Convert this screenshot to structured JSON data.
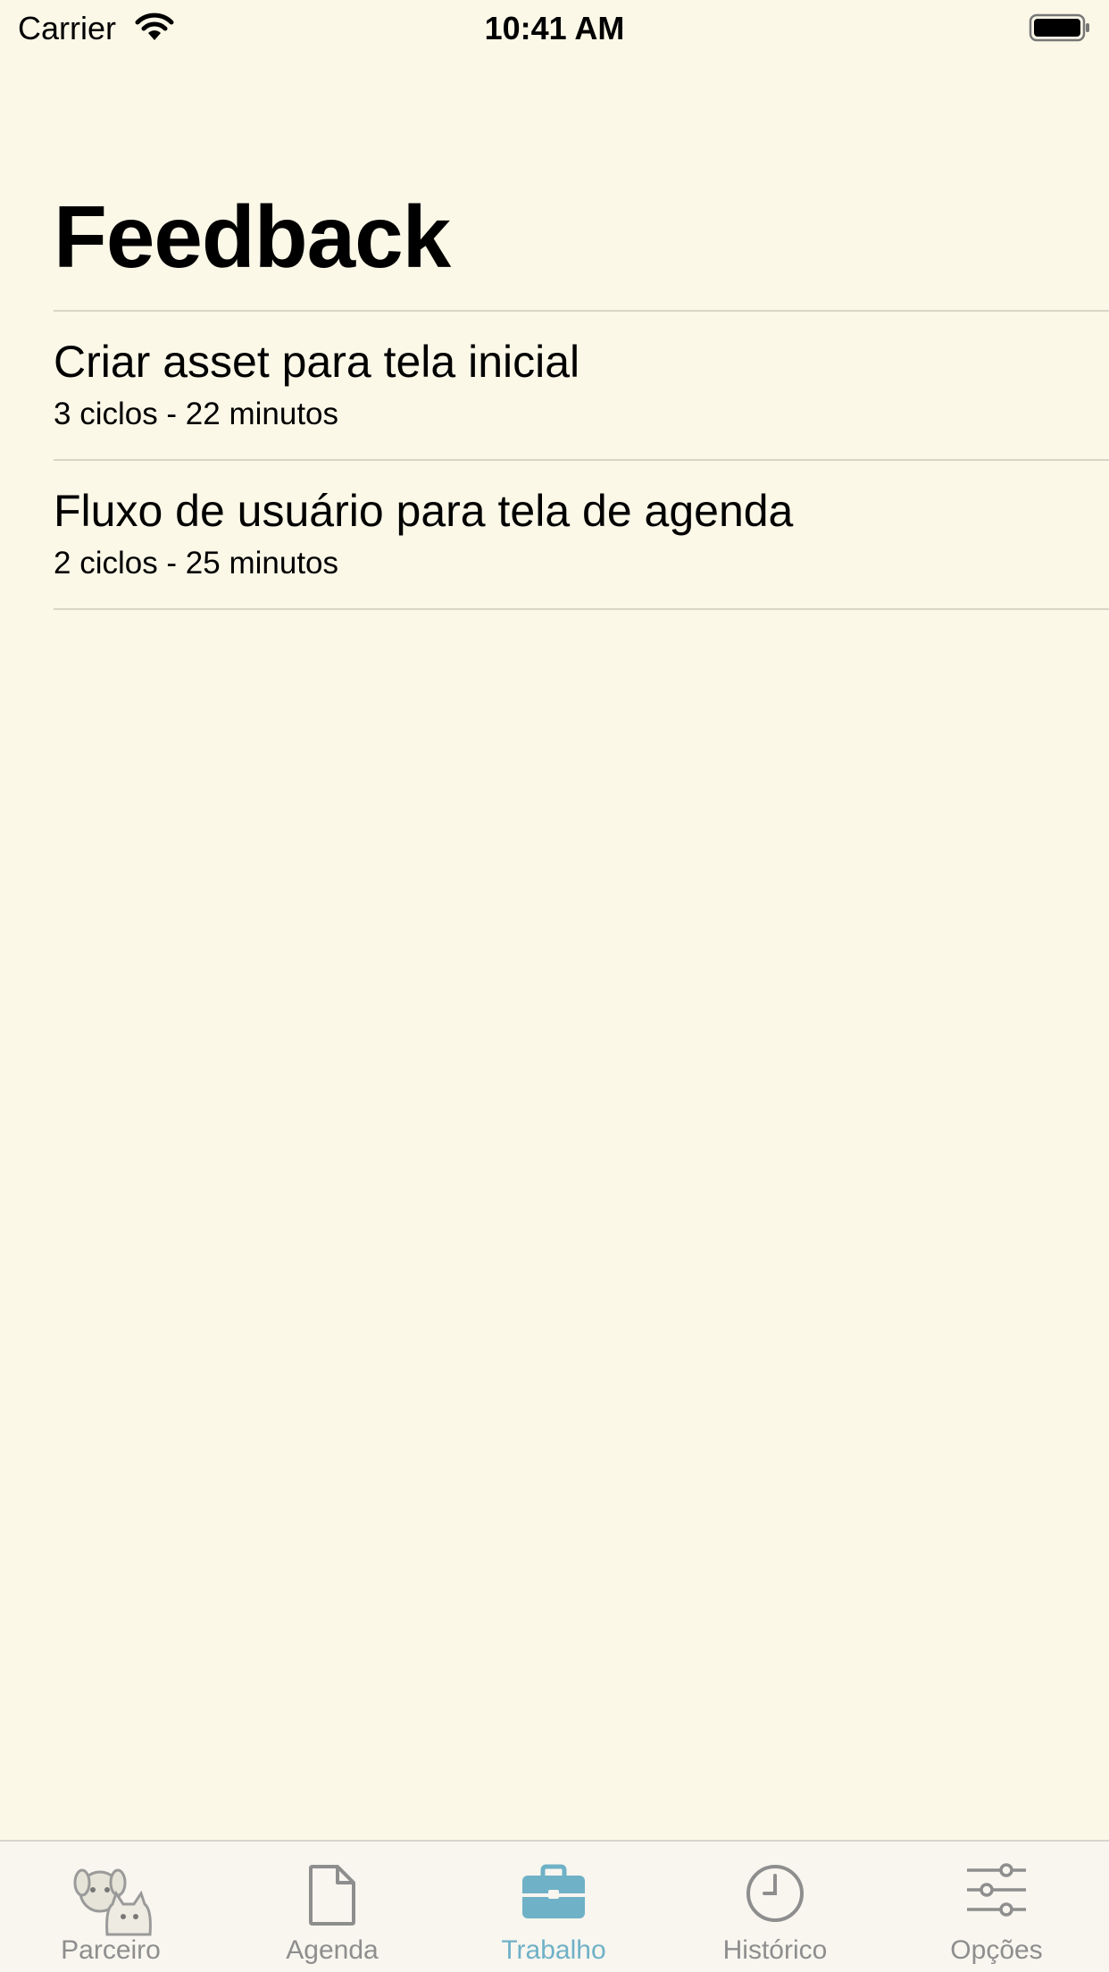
{
  "status_bar": {
    "carrier": "Carrier",
    "time": "10:41 AM"
  },
  "page": {
    "title": "Feedback"
  },
  "items": [
    {
      "title": "Criar asset para tela inicial",
      "subtitle": "3 ciclos - 22 minutos"
    },
    {
      "title": "Fluxo de usuário para tela de agenda",
      "subtitle": "2 ciclos - 25 minutos"
    }
  ],
  "tabs": [
    {
      "label": "Parceiro",
      "icon": "pets-icon",
      "active": false
    },
    {
      "label": "Agenda",
      "icon": "document-icon",
      "active": false
    },
    {
      "label": "Trabalho",
      "icon": "briefcase-icon",
      "active": true
    },
    {
      "label": "Histórico",
      "icon": "clock-icon",
      "active": false
    },
    {
      "label": "Opções",
      "icon": "sliders-icon",
      "active": false
    }
  ],
  "colors": {
    "background": "#fbf8e8",
    "accent": "#6fb1c7",
    "inactive": "#8e8e8e"
  }
}
